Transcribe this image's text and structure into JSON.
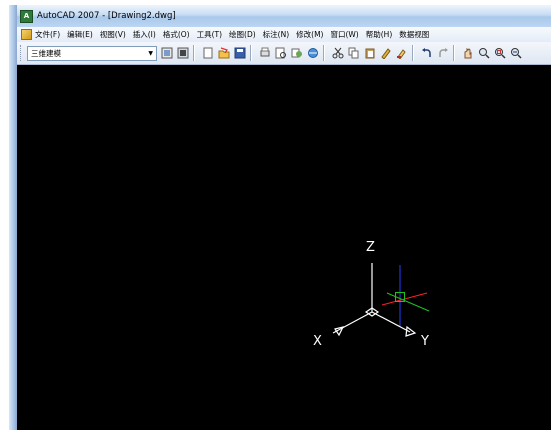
{
  "window": {
    "title": "AutoCAD 2007 - [Drawing2.dwg]",
    "app_icon_glyph": "A"
  },
  "menu": {
    "items": [
      "文件(F)",
      "编辑(E)",
      "视图(V)",
      "插入(I)",
      "格式(O)",
      "工具(T)",
      "绘图(D)",
      "标注(N)",
      "修改(M)",
      "窗口(W)",
      "帮助(H)",
      "数据视图"
    ]
  },
  "toolbar": {
    "workspace_value": "三维建模",
    "icons": [
      "workspace-settings-icon",
      "workspace-toggle-icon",
      "new-icon",
      "open-icon",
      "save-icon",
      "plot-icon",
      "plot-preview-icon",
      "publish-icon",
      "3d-dwf-icon",
      "cut-icon",
      "copy-icon",
      "paste-icon",
      "match-properties-icon",
      "block-editor-icon",
      "undo-icon",
      "redo-icon",
      "pan-icon",
      "zoom-realtime-icon",
      "zoom-window-icon",
      "zoom-previous-icon"
    ]
  },
  "viewport": {
    "axis_x": "X",
    "axis_y": "Y",
    "axis_z": "Z",
    "background": "#000000",
    "ucs_color": "#ffffff",
    "cursor_colors": {
      "x": "#ff2020",
      "y": "#20c020",
      "z": "#2040ff"
    }
  }
}
